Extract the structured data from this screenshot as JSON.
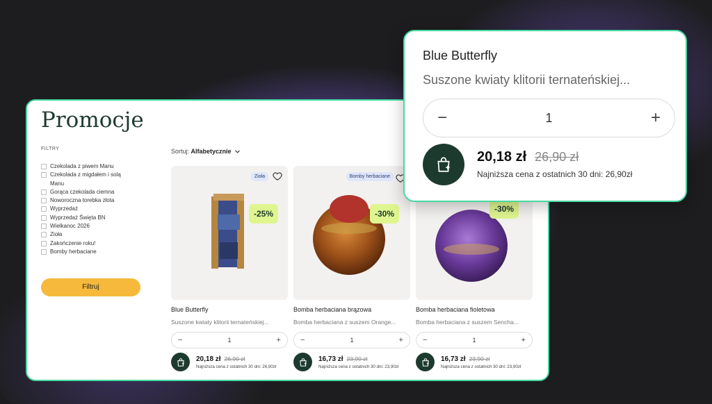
{
  "page": {
    "title": "Promocje",
    "filters_label": "FILTRY",
    "filter_button": "Filtruj",
    "sort_label": "Sortuj:",
    "sort_value": "Alfabetycznie"
  },
  "filters": [
    {
      "label": "Czekolada z piwem Manu"
    },
    {
      "label": "Czekolada z migdałem i solą Manu"
    },
    {
      "label": "Gorąca czekolada ciemna"
    },
    {
      "label": "Noworoczna torebka złota"
    },
    {
      "label": "Wyprzedaż"
    },
    {
      "label": "Wyprzedaż Święta BN"
    },
    {
      "label": "Wielkanoc 2026"
    },
    {
      "label": "Zioła"
    },
    {
      "label": "Zakończenie roku!"
    },
    {
      "label": "Bomby herbaciane"
    }
  ],
  "products": [
    {
      "tag": "Zioła",
      "discount": "-25%",
      "name": "Blue Butterfly",
      "desc": "Suszone kwiaty klitorii ternateńskiej...",
      "qty": "1",
      "price": "20,18 zł",
      "old_price": "26,90 zł",
      "lowest": "Najniższa cena z ostatnich 30 dni: 26,90zł"
    },
    {
      "tag": "Bomby herbaciane",
      "discount": "-30%",
      "name": "Bomba herbaciana brązowa",
      "desc": "Bomba herbaciana z suszem Orange...",
      "qty": "1",
      "price": "16,73 zł",
      "old_price": "23,90 zł",
      "lowest": "Najniższa cena z ostatnich 30 dni: 23,90zł"
    },
    {
      "tag": "",
      "discount": "-30%",
      "name": "Bomba herbaciana fioletowa",
      "desc": "Bomba herbaciana z suszem Sencha...",
      "qty": "1",
      "price": "16,73 zł",
      "old_price": "23,90 zł",
      "lowest": "Najniższa cena z ostatnich 30 dni: 23,90zł"
    }
  ],
  "zoom": {
    "name": "Blue Butterfly",
    "desc": "Suszone kwiaty klitorii ternateńskiej...",
    "qty": "1",
    "price": "20,18 zł",
    "old_price": "26,90 zł",
    "lowest": "Najniższa cena z ostatnich 30 dni: 26,90zł"
  },
  "icons": {
    "stepper_minus": "−",
    "stepper_plus": "+",
    "sort_chevron": "⌄"
  },
  "colors": {
    "accent_green": "#47d9a0",
    "dark_green": "#1d3a2f",
    "filter_button": "#f6b93b",
    "discount_badge": "#dff58f",
    "background_purple": "#8c69eb"
  }
}
